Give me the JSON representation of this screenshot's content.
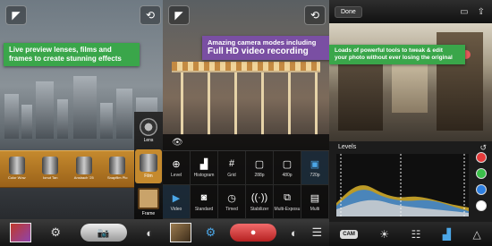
{
  "panel1": {
    "banner_line1": "Live preview lenses, films and",
    "banner_line2": "frames to create stunning effects",
    "films": [
      {
        "label": "Color Wow"
      },
      {
        "label": "Ionut Tan"
      },
      {
        "label": "Ansbach '25"
      },
      {
        "label": "Snapfilm Plo"
      }
    ],
    "side_items": [
      {
        "label": "Lens"
      },
      {
        "label": "Film"
      },
      {
        "label": "Frame"
      }
    ],
    "toolbar": {
      "shutter_icon": "camera-icon",
      "settings_icon": "gear-icon",
      "effects_icon": "contrast-icon"
    }
  },
  "panel2": {
    "banner_line1": "Amazing camera modes including",
    "banner_line2": "Full HD video recording",
    "row1": [
      {
        "label": "Level",
        "icon": "level-icon"
      },
      {
        "label": "Histogram",
        "icon": "histogram-icon"
      },
      {
        "label": "Grid",
        "icon": "grid-icon"
      },
      {
        "label": "288p",
        "icon": "res-288-icon"
      },
      {
        "label": "480p",
        "icon": "res-480-icon"
      },
      {
        "label": "720p",
        "icon": "res-720-icon"
      }
    ],
    "row2": [
      {
        "label": "Video",
        "icon": "video-icon"
      },
      {
        "label": "Standard",
        "icon": "camera-icon"
      },
      {
        "label": "Timed",
        "icon": "timer-icon"
      },
      {
        "label": "Stabilizer",
        "icon": "stabilizer-icon"
      },
      {
        "label": "Multi-Exposu",
        "icon": "multi-exposure-icon"
      },
      {
        "label": "Multi",
        "icon": "multi-icon"
      }
    ]
  },
  "panel3": {
    "done_label": "Done",
    "banner_line1": "Loads of powerful tools to tweak & edit",
    "banner_line2": "your photo without ever losing the original",
    "levels_title": "Levels",
    "cam_label": "CAM",
    "dots": [
      "#e53b3b",
      "#3bbf4a",
      "#2e7fe0",
      "#ffffff"
    ]
  }
}
